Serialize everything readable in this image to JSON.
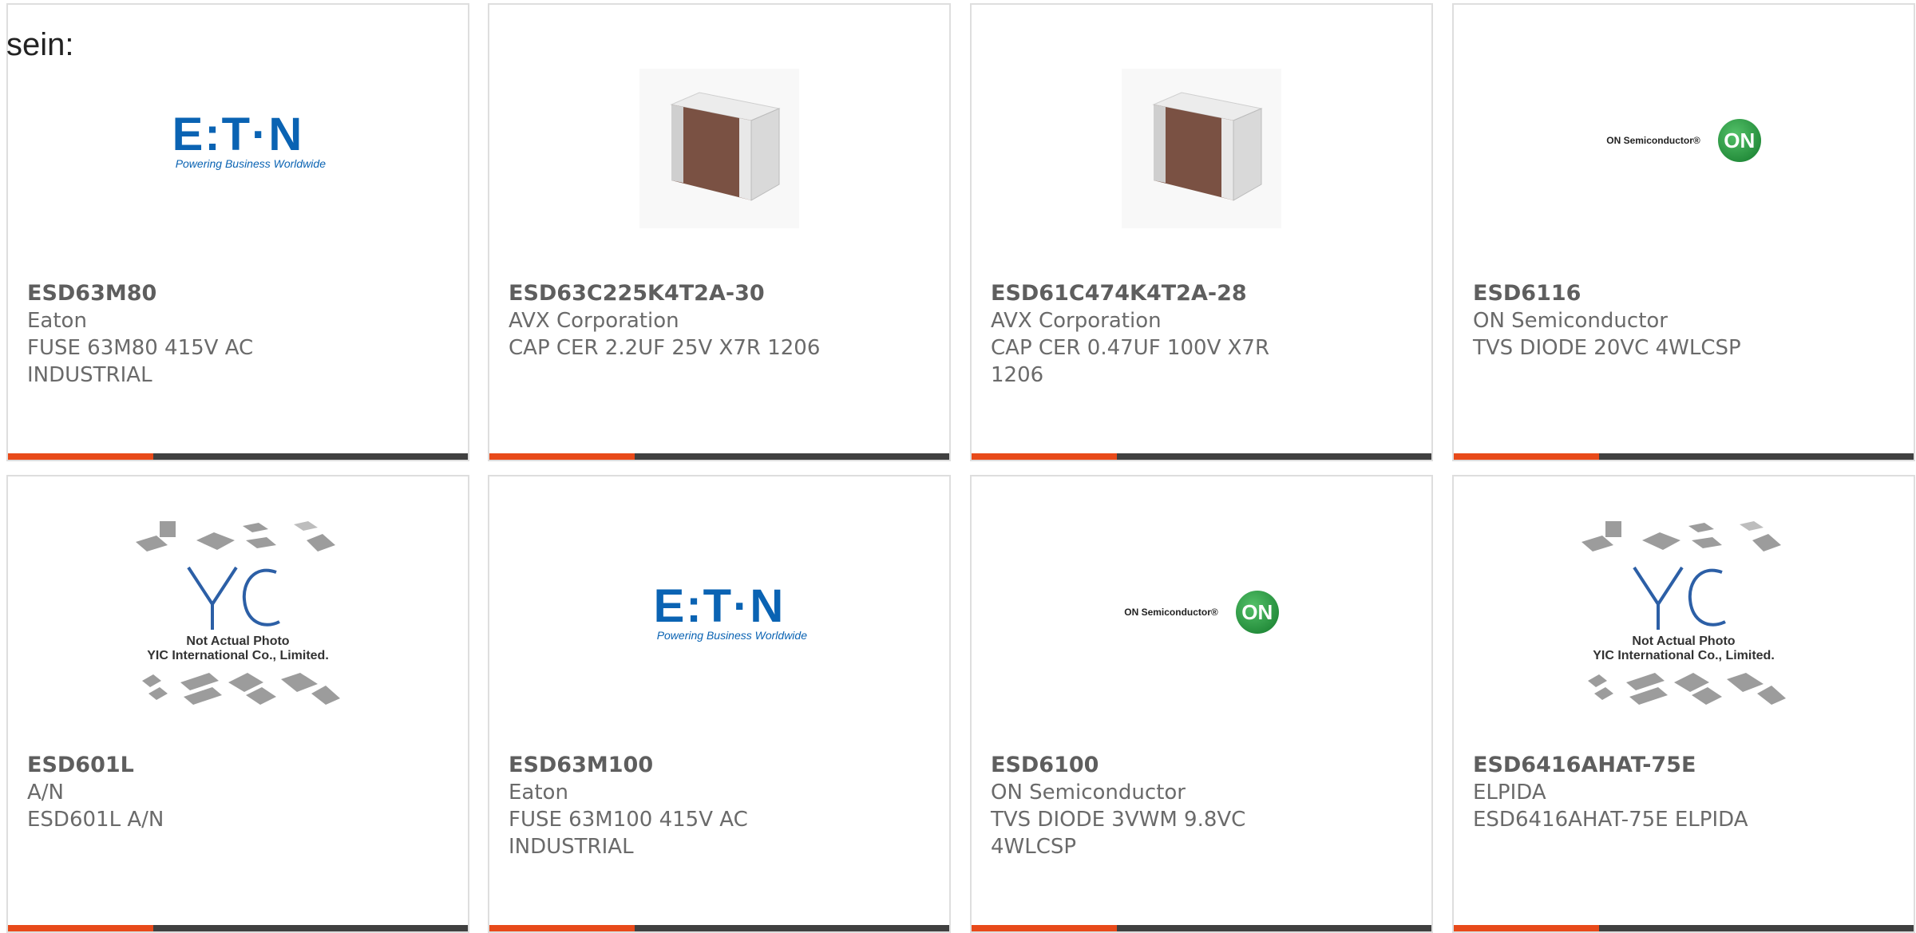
{
  "intro_text": "sein:",
  "accent_color": "#e84a1a",
  "bar_color": "#404040",
  "products": [
    {
      "part_number": "ESD63M80",
      "manufacturer": "Eaton",
      "description": "FUSE 63M80 415V AC INDUSTRIAL",
      "image": "eaton-logo"
    },
    {
      "part_number": "ESD63C225K4T2A-30",
      "manufacturer": "AVX Corporation",
      "description": "CAP CER 2.2UF 25V X7R 1206",
      "image": "ceramic-capacitor-photo"
    },
    {
      "part_number": "ESD61C474K4T2A-28",
      "manufacturer": "AVX Corporation",
      "description": "CAP CER 0.47UF 100V X7R 1206",
      "image": "ceramic-capacitor-photo"
    },
    {
      "part_number": "ESD6116",
      "manufacturer": "ON Semiconductor",
      "description": "TVS DIODE 20VC 4WLCSP",
      "image": "on-semiconductor-logo"
    },
    {
      "part_number": "ESD601L",
      "manufacturer": "A/N",
      "description": "ESD601L A/N",
      "image": "yic-placeholder"
    },
    {
      "part_number": "ESD63M100",
      "manufacturer": "Eaton",
      "description": "FUSE 63M100 415V AC INDUSTRIAL",
      "image": "eaton-logo"
    },
    {
      "part_number": "ESD6100",
      "manufacturer": "ON Semiconductor",
      "description": "TVS DIODE 3VWM 9.8VC 4WLCSP",
      "image": "on-semiconductor-logo"
    },
    {
      "part_number": "ESD6416AHAT-75E",
      "manufacturer": "ELPIDA",
      "description": "ESD6416AHAT-75E ELPIDA",
      "image": "yic-placeholder"
    }
  ],
  "logos": {
    "eaton_word": "E:T·N",
    "eaton_tagline": "Powering Business Worldwide",
    "onsemi_text": "ON Semiconductor®",
    "onsemi_badge": "ON",
    "yic_caption_1": "Not Actual Photo",
    "yic_caption_2": "YIC International Co., Limited."
  }
}
